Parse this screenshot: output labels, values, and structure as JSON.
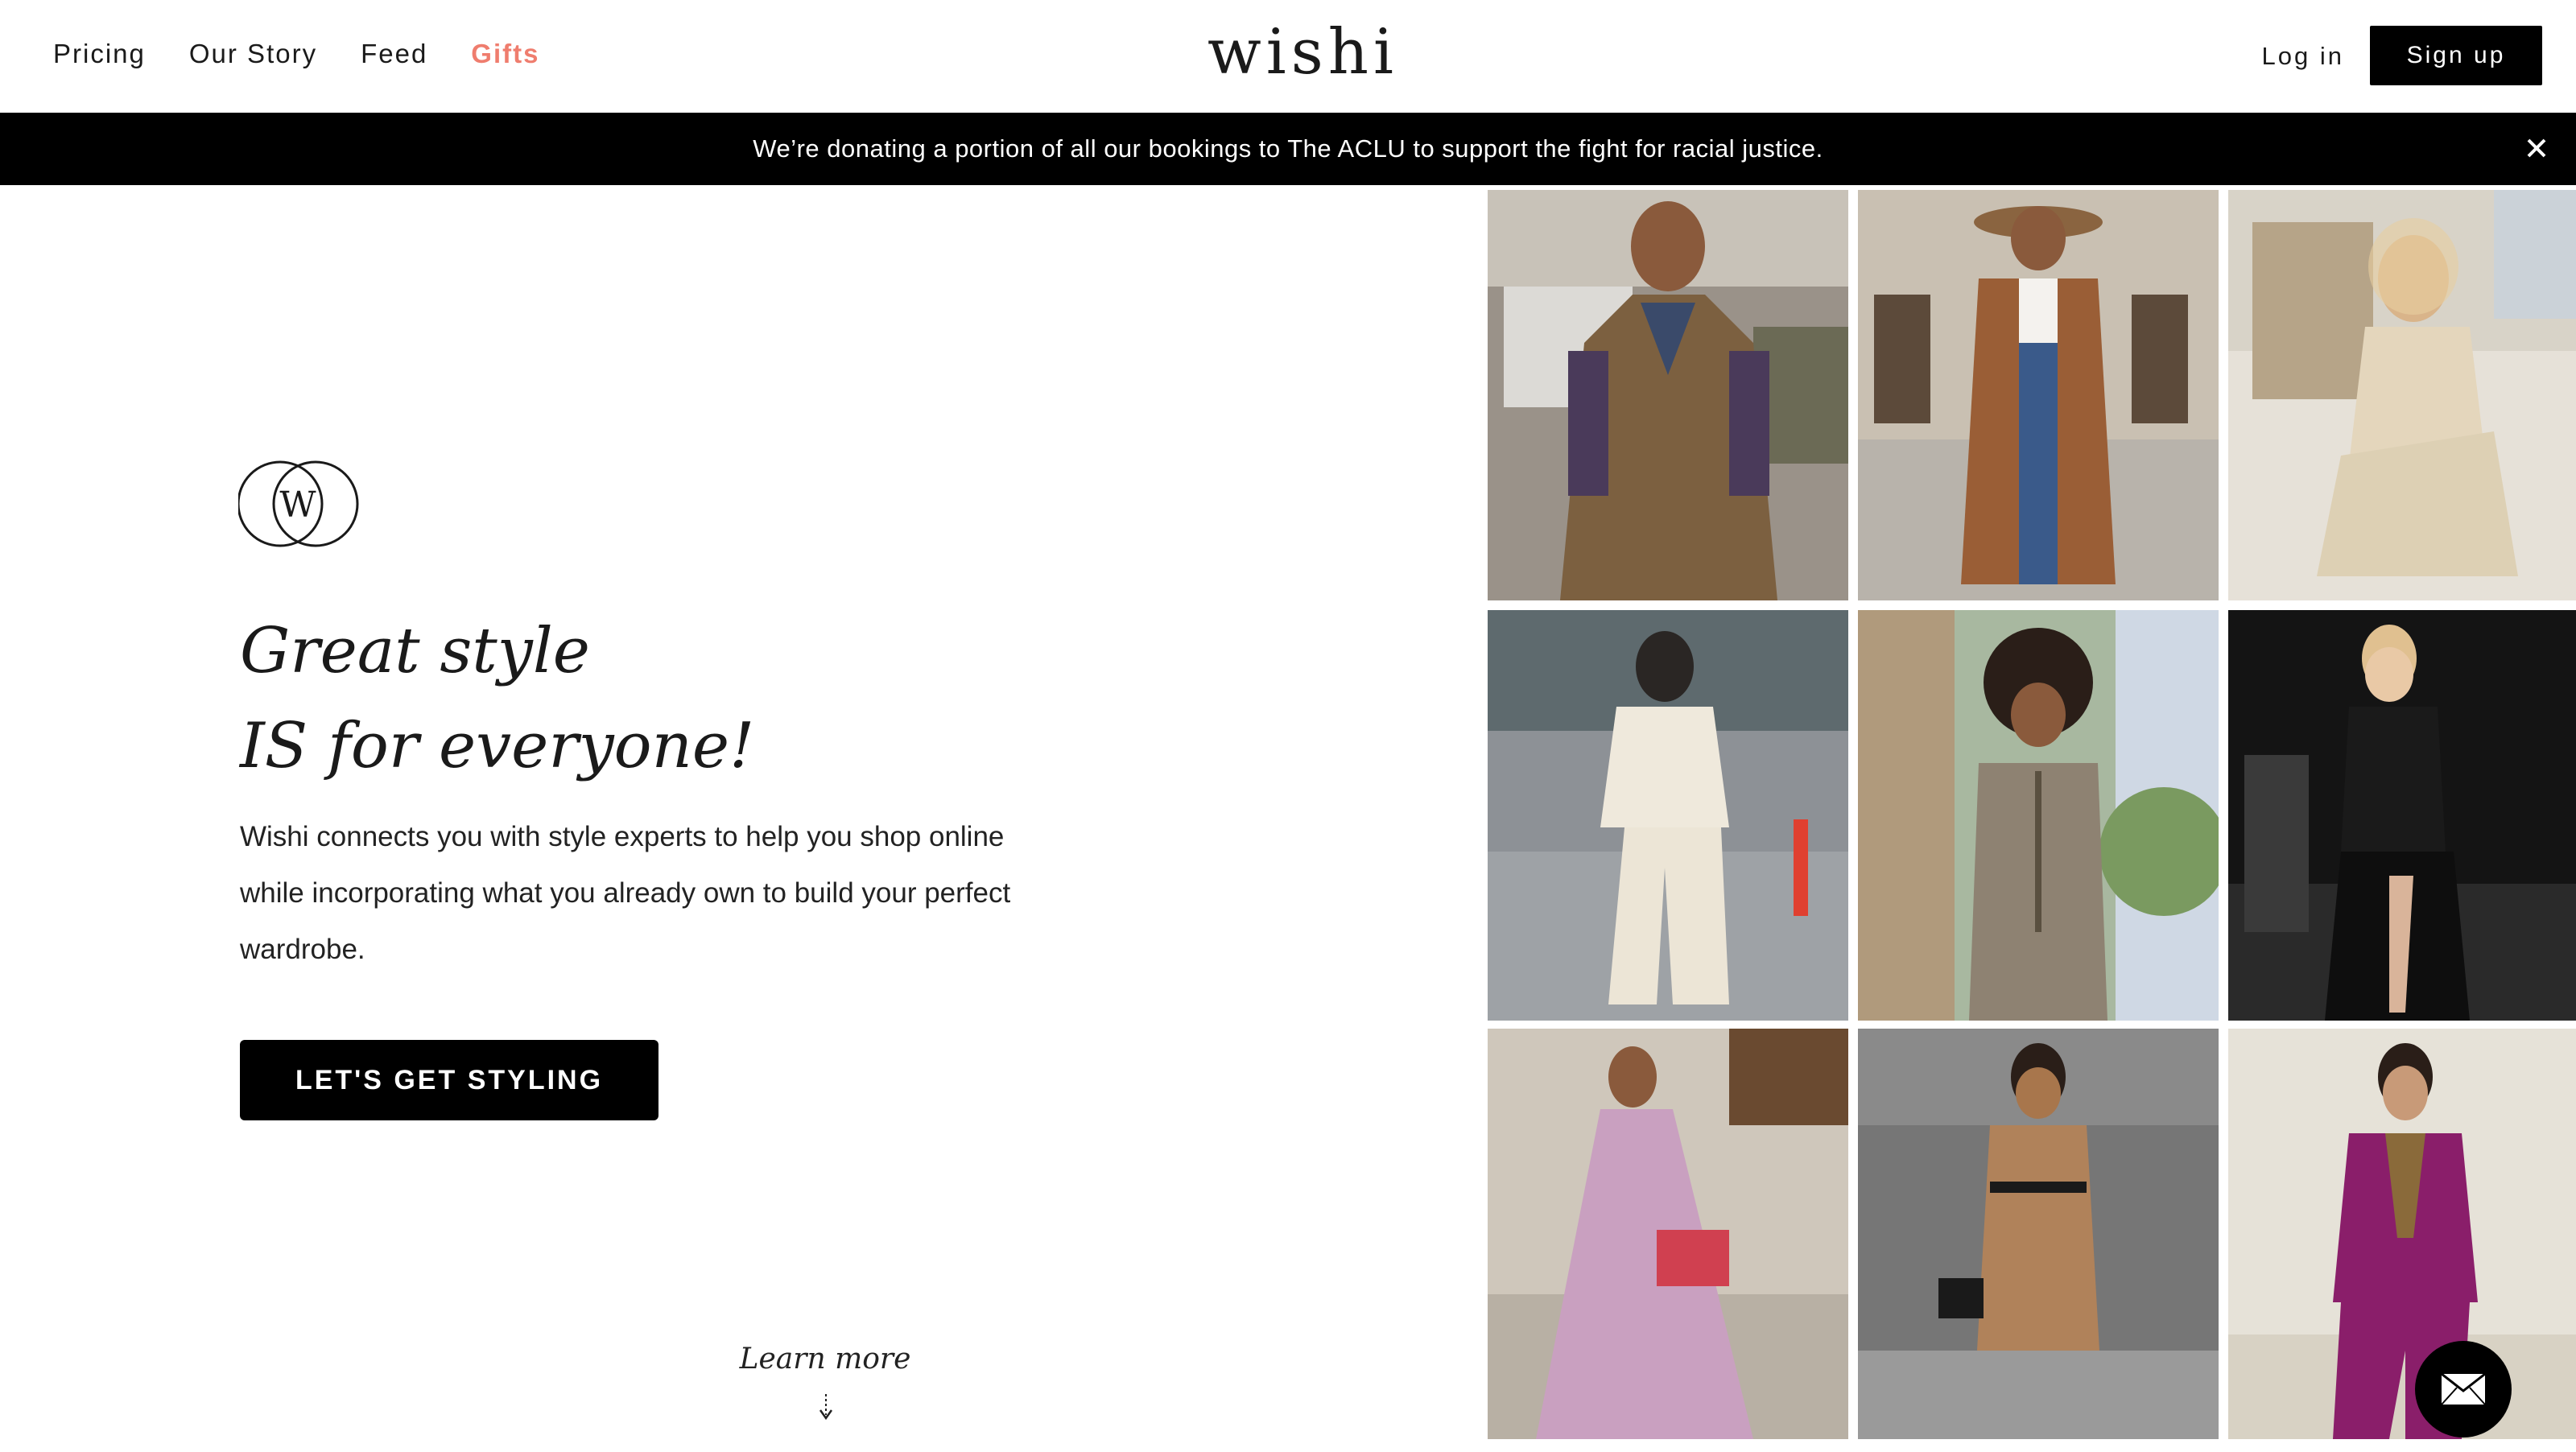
{
  "header": {
    "nav": [
      {
        "label": "Pricing"
      },
      {
        "label": "Our Story"
      },
      {
        "label": "Feed"
      },
      {
        "label": "Gifts"
      }
    ],
    "logo": "wishi",
    "login": "Log in",
    "signup": "Sign up"
  },
  "banner": {
    "text": "We’re donating a portion of all our bookings to The ACLU to support the fight for racial justice."
  },
  "hero": {
    "emblem_letter": "W",
    "headline_line1": "Great style",
    "headline_line2": "IS for everyone!",
    "description": "Wishi connects you with style experts to help you shop online while incorporating what you already own to build your perfect wardrobe.",
    "cta": "LET'S GET STYLING",
    "learn_more": "Learn more"
  },
  "gallery": {
    "photo_icons": [
      "photo",
      "photo",
      "photo",
      "photo",
      "photo",
      "photo",
      "photo",
      "photo",
      "photo"
    ]
  },
  "colors": {
    "accent": "#ef7d6e",
    "banner_bg": "#000000",
    "button_bg": "#000000"
  },
  "icons": {
    "close": "close-icon",
    "chat": "mail-icon",
    "arrow": "arrow-down-icon"
  }
}
